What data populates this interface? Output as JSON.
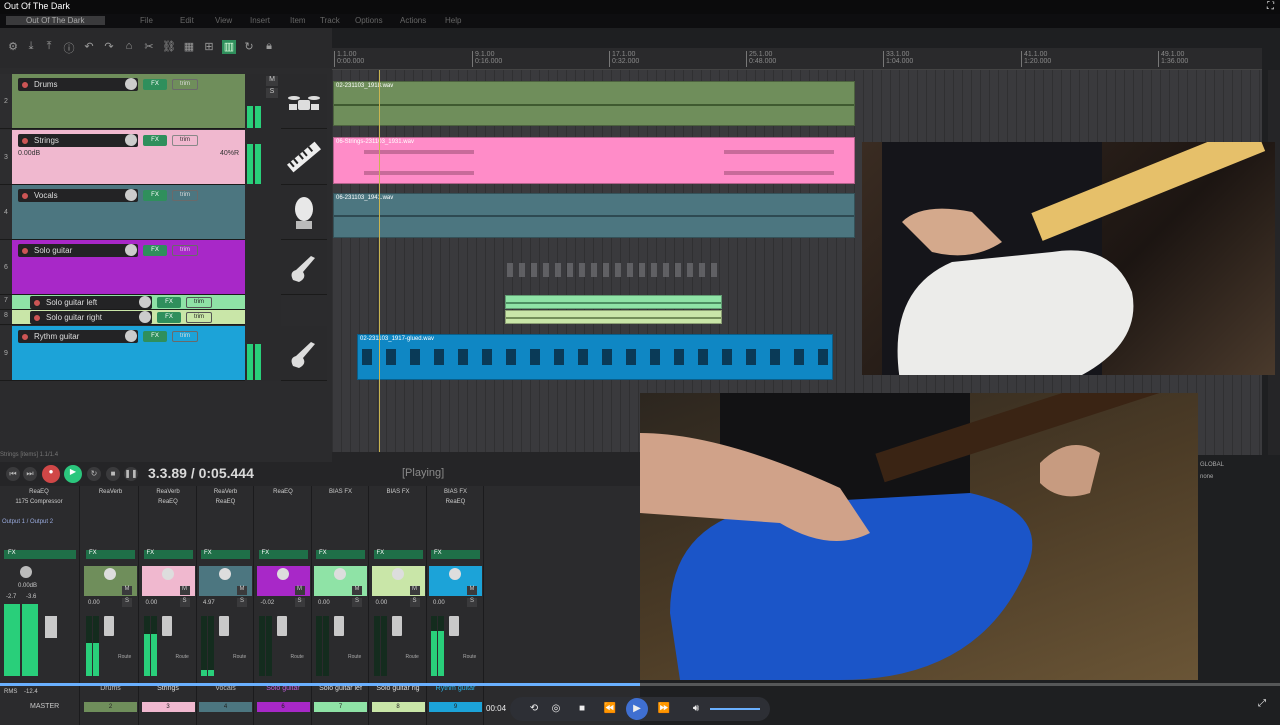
{
  "window": {
    "title": "Out Of The Dark"
  },
  "menubar": {
    "items": [
      "File",
      "Edit",
      "View",
      "Insert",
      "Item",
      "Track",
      "Options",
      "Actions",
      "Help"
    ],
    "right_text": "Out Of The Dark"
  },
  "ruler": {
    "marks": [
      {
        "bar": "1.1.00",
        "time": "0:00.000"
      },
      {
        "bar": "9.1.00",
        "time": "0:16.000"
      },
      {
        "bar": "17.1.00",
        "time": "0:32.000"
      },
      {
        "bar": "25.1.00",
        "time": "0:48.000"
      },
      {
        "bar": "33.1.00",
        "time": "1:04.000"
      },
      {
        "bar": "41.1.00",
        "time": "1:20.000"
      },
      {
        "bar": "49.1.00",
        "time": "1:36.000"
      }
    ]
  },
  "tracks": [
    {
      "num": "2",
      "name": "Drums",
      "color": "#6f8e5b",
      "fx": "FX",
      "trim": "trim",
      "clip": "02-231103_1918.wav"
    },
    {
      "num": "3",
      "name": "Strings",
      "color": "#f0b8cf",
      "fx": "FX",
      "trim": "trim",
      "volume": "0.00dB",
      "pan": "40%R",
      "clip": "06-Strings-231103_1931.wav"
    },
    {
      "num": "4",
      "name": "Vocals",
      "color": "#4c7680",
      "fx": "FX",
      "trim": "trim",
      "clip": "06-231103_1941.wav"
    },
    {
      "num": "6",
      "name": "Solo guitar",
      "color": "#a828c8",
      "fx": "FX",
      "trim": "trim"
    },
    {
      "num": "7",
      "name": "Solo guitar left",
      "color": "#8fe3a6",
      "fx": "FX",
      "trim": "trim"
    },
    {
      "num": "8",
      "name": "Solo guitar right",
      "color": "#c9e6a8",
      "fx": "FX",
      "trim": "trim"
    },
    {
      "num": "9",
      "name": "Rythm guitar",
      "color": "#1ca3d8",
      "fx": "FX",
      "trim": "trim",
      "clip": "02-231103_1917-glued.wav"
    }
  ],
  "transport": {
    "position": "3.3.89 / 0:05.444",
    "status": "[Playing]",
    "label": "Strings [items] 1.1/1.4"
  },
  "mixer": {
    "master": {
      "fx": [
        "ReaEQ",
        "1175 Compressor"
      ],
      "io": "Output 1 / Output 2",
      "vol": "0.00dB",
      "peak_l": "-2.7",
      "peak_r": "-3.6",
      "rms_label": "RMS",
      "rms_value": "-12.4",
      "name": "MASTER"
    },
    "strips": [
      {
        "name": "Drums",
        "fx": [
          "ReaVerb",
          ""
        ],
        "vol": "0.00",
        "num": "2",
        "color": "#6f8e5b",
        "meter": 0.55
      },
      {
        "name": "Strings",
        "fx": [
          "ReaVerb",
          "ReaEQ"
        ],
        "vol": "0.00",
        "num": "3",
        "color": "#f0b8cf",
        "meter": 0.7
      },
      {
        "name": "Vocals",
        "fx": [
          "ReaVerb",
          "ReaEQ"
        ],
        "vol": "4.97",
        "num": "4",
        "color": "#4c7680",
        "meter": 0.1
      },
      {
        "name": "Solo guitar",
        "fx": [
          "ReaEQ",
          ""
        ],
        "vol": "-0.02",
        "num": "6",
        "color": "#a828c8",
        "meter": 0.0
      },
      {
        "name": "Solo guitar lef",
        "fx": [
          "BIAS FX",
          ""
        ],
        "vol": "0.00",
        "num": "7",
        "color": "#8fe3a6",
        "meter": 0.0
      },
      {
        "name": "Solo guitar rig",
        "fx": [
          "BIAS FX",
          ""
        ],
        "vol": "0.00",
        "num": "8",
        "color": "#c9e6a8",
        "meter": 0.0
      },
      {
        "name": "Rythm guitar",
        "fx": [
          "BIAS FX",
          "ReaEQ"
        ],
        "vol": "0.00",
        "num": "9",
        "color": "#1ca3d8",
        "meter": 0.75
      }
    ],
    "mute_label": "M",
    "solo_label": "S",
    "route_label": "Route"
  },
  "player": {
    "time": "00:04",
    "progress": 0.5
  },
  "right_panel": {
    "global_label": "GLOBAL",
    "none_label": "none"
  }
}
